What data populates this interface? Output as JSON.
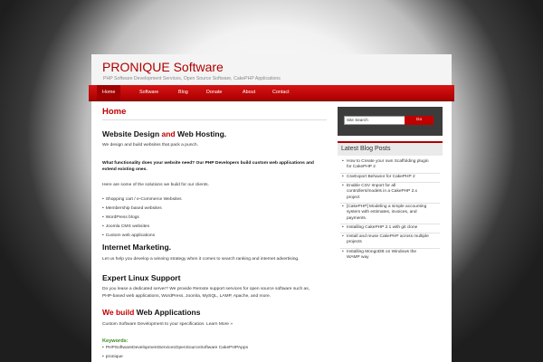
{
  "header": {
    "site_title": "PRONIQUE Software",
    "tagline": "PHP Software Development Services, Open Source Software, CakePHP Applications"
  },
  "nav": {
    "items": [
      {
        "label": "Home",
        "active": true
      },
      {
        "label": "Software"
      },
      {
        "label": "Blog"
      },
      {
        "label": "Donate"
      },
      {
        "label": "About"
      },
      {
        "label": "Contact"
      }
    ]
  },
  "content": {
    "page_title": "Home",
    "section1": {
      "heading_a": "Website Design ",
      "heading_b": "and",
      "heading_c": " Web Hosting.",
      "intro": "We design and build websites that pack a punch.",
      "bold_line1": "What functionality does your website need? Our PHP Developers build custom web applications and",
      "bold_line2": "extend existing ones.",
      "solutions_intro": "Here are some of the solutions we build for our clients.",
      "list": [
        "Shopping cart / e-Commerce Websites",
        "Membership based websites",
        "WordPress blogs",
        "Joomla CMS websites",
        "Custom web applications"
      ]
    },
    "section2": {
      "heading": "Internet Marketing.",
      "text": "Let us help you develop a winning strategy when it comes to search ranking and internet advertising."
    },
    "section3": {
      "heading": "Expert Linux Support",
      "text1": "Do you lease a dedicated server? We provide Remote support services for open source software such as,",
      "text2": "PHP-based web applications, WordPress, Joomla, MySQL, LAMP, Apache, and more."
    },
    "section4": {
      "heading_a": "We build",
      "heading_b": " Web Applications",
      "text": "Custom Software Development to your specification. Learn More »"
    },
    "keywords": {
      "label": "Keywords:",
      "items": [
        "PHPSoftwareDevelopmentServicesOpenSourceSoftware CakePHPApps",
        "pronique"
      ]
    }
  },
  "sidebar": {
    "search": {
      "placeholder": "Site Search",
      "value": "Site Search",
      "button_label": "Go"
    },
    "widget_title": "Latest Blog Posts",
    "posts": [
      [
        "How to Create your own Scaffolding plugin",
        "for CakePHP 2"
      ],
      [
        "CsvExport Behavior for CakePHP 2"
      ],
      [
        "Enable CSV Import for all",
        "controllers/models in a CakePHP 2.x",
        "project"
      ],
      [
        "[CakePHP] Modeling a simple accounting",
        "system with estimates, invoices, and",
        "payments."
      ],
      [
        "Installing CakePHP 2.1 with git clone"
      ],
      [
        "Install and reuse CakePHP across multiple",
        "projects"
      ],
      [
        "Installing MongoDB on Windows the",
        "WAMP way"
      ]
    ]
  }
}
